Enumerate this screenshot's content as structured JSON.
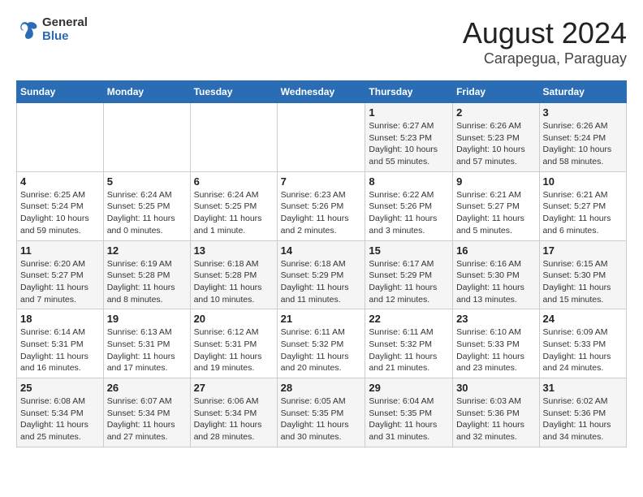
{
  "header": {
    "logo_general": "General",
    "logo_blue": "Blue",
    "title": "August 2024",
    "subtitle": "Carapegua, Paraguay"
  },
  "days_of_week": [
    "Sunday",
    "Monday",
    "Tuesday",
    "Wednesday",
    "Thursday",
    "Friday",
    "Saturday"
  ],
  "weeks": [
    [
      {
        "num": "",
        "detail": ""
      },
      {
        "num": "",
        "detail": ""
      },
      {
        "num": "",
        "detail": ""
      },
      {
        "num": "",
        "detail": ""
      },
      {
        "num": "1",
        "detail": "Sunrise: 6:27 AM\nSunset: 5:23 PM\nDaylight: 10 hours\nand 55 minutes."
      },
      {
        "num": "2",
        "detail": "Sunrise: 6:26 AM\nSunset: 5:23 PM\nDaylight: 10 hours\nand 57 minutes."
      },
      {
        "num": "3",
        "detail": "Sunrise: 6:26 AM\nSunset: 5:24 PM\nDaylight: 10 hours\nand 58 minutes."
      }
    ],
    [
      {
        "num": "4",
        "detail": "Sunrise: 6:25 AM\nSunset: 5:24 PM\nDaylight: 10 hours\nand 59 minutes."
      },
      {
        "num": "5",
        "detail": "Sunrise: 6:24 AM\nSunset: 5:25 PM\nDaylight: 11 hours\nand 0 minutes."
      },
      {
        "num": "6",
        "detail": "Sunrise: 6:24 AM\nSunset: 5:25 PM\nDaylight: 11 hours\nand 1 minute."
      },
      {
        "num": "7",
        "detail": "Sunrise: 6:23 AM\nSunset: 5:26 PM\nDaylight: 11 hours\nand 2 minutes."
      },
      {
        "num": "8",
        "detail": "Sunrise: 6:22 AM\nSunset: 5:26 PM\nDaylight: 11 hours\nand 3 minutes."
      },
      {
        "num": "9",
        "detail": "Sunrise: 6:21 AM\nSunset: 5:27 PM\nDaylight: 11 hours\nand 5 minutes."
      },
      {
        "num": "10",
        "detail": "Sunrise: 6:21 AM\nSunset: 5:27 PM\nDaylight: 11 hours\nand 6 minutes."
      }
    ],
    [
      {
        "num": "11",
        "detail": "Sunrise: 6:20 AM\nSunset: 5:27 PM\nDaylight: 11 hours\nand 7 minutes."
      },
      {
        "num": "12",
        "detail": "Sunrise: 6:19 AM\nSunset: 5:28 PM\nDaylight: 11 hours\nand 8 minutes."
      },
      {
        "num": "13",
        "detail": "Sunrise: 6:18 AM\nSunset: 5:28 PM\nDaylight: 11 hours\nand 10 minutes."
      },
      {
        "num": "14",
        "detail": "Sunrise: 6:18 AM\nSunset: 5:29 PM\nDaylight: 11 hours\nand 11 minutes."
      },
      {
        "num": "15",
        "detail": "Sunrise: 6:17 AM\nSunset: 5:29 PM\nDaylight: 11 hours\nand 12 minutes."
      },
      {
        "num": "16",
        "detail": "Sunrise: 6:16 AM\nSunset: 5:30 PM\nDaylight: 11 hours\nand 13 minutes."
      },
      {
        "num": "17",
        "detail": "Sunrise: 6:15 AM\nSunset: 5:30 PM\nDaylight: 11 hours\nand 15 minutes."
      }
    ],
    [
      {
        "num": "18",
        "detail": "Sunrise: 6:14 AM\nSunset: 5:31 PM\nDaylight: 11 hours\nand 16 minutes."
      },
      {
        "num": "19",
        "detail": "Sunrise: 6:13 AM\nSunset: 5:31 PM\nDaylight: 11 hours\nand 17 minutes."
      },
      {
        "num": "20",
        "detail": "Sunrise: 6:12 AM\nSunset: 5:31 PM\nDaylight: 11 hours\nand 19 minutes."
      },
      {
        "num": "21",
        "detail": "Sunrise: 6:11 AM\nSunset: 5:32 PM\nDaylight: 11 hours\nand 20 minutes."
      },
      {
        "num": "22",
        "detail": "Sunrise: 6:11 AM\nSunset: 5:32 PM\nDaylight: 11 hours\nand 21 minutes."
      },
      {
        "num": "23",
        "detail": "Sunrise: 6:10 AM\nSunset: 5:33 PM\nDaylight: 11 hours\nand 23 minutes."
      },
      {
        "num": "24",
        "detail": "Sunrise: 6:09 AM\nSunset: 5:33 PM\nDaylight: 11 hours\nand 24 minutes."
      }
    ],
    [
      {
        "num": "25",
        "detail": "Sunrise: 6:08 AM\nSunset: 5:34 PM\nDaylight: 11 hours\nand 25 minutes."
      },
      {
        "num": "26",
        "detail": "Sunrise: 6:07 AM\nSunset: 5:34 PM\nDaylight: 11 hours\nand 27 minutes."
      },
      {
        "num": "27",
        "detail": "Sunrise: 6:06 AM\nSunset: 5:34 PM\nDaylight: 11 hours\nand 28 minutes."
      },
      {
        "num": "28",
        "detail": "Sunrise: 6:05 AM\nSunset: 5:35 PM\nDaylight: 11 hours\nand 30 minutes."
      },
      {
        "num": "29",
        "detail": "Sunrise: 6:04 AM\nSunset: 5:35 PM\nDaylight: 11 hours\nand 31 minutes."
      },
      {
        "num": "30",
        "detail": "Sunrise: 6:03 AM\nSunset: 5:36 PM\nDaylight: 11 hours\nand 32 minutes."
      },
      {
        "num": "31",
        "detail": "Sunrise: 6:02 AM\nSunset: 5:36 PM\nDaylight: 11 hours\nand 34 minutes."
      }
    ]
  ]
}
